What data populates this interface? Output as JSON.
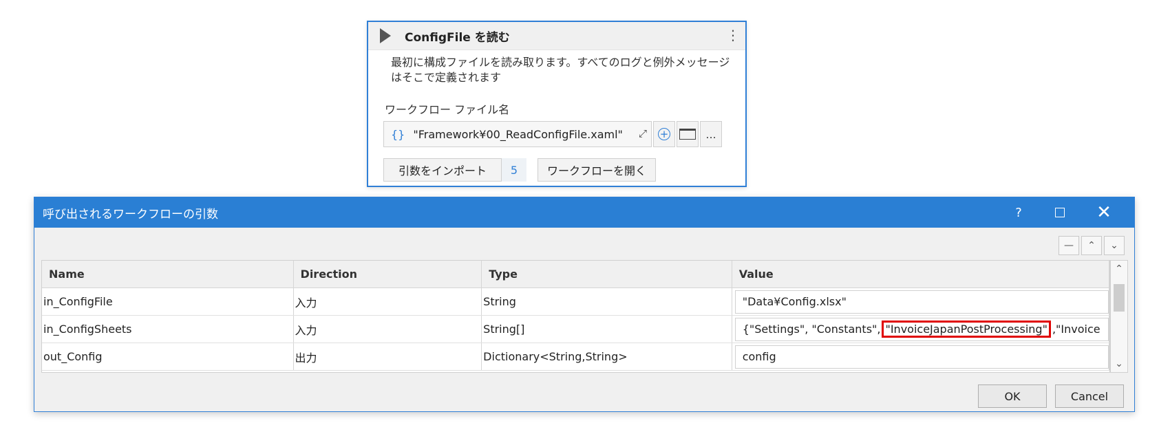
{
  "activity": {
    "title": "ConfigFile を読む",
    "more_icon": "⋮",
    "description": "最初に構成ファイルを読み取ります。すべてのログと例外メッセージはそこで定義されます",
    "workflow_label": "ワークフロー ファイル名",
    "workflow_file": "\"Framework¥00_ReadConfigFile.xaml\"",
    "brace_icon": "{}",
    "expand_icon": "⤢",
    "plus_icon": "+",
    "ellipsis": "...",
    "import_button": "引数をインポート",
    "import_count": "5",
    "open_button": "ワークフローを開く"
  },
  "dialog": {
    "title": "呼び出されるワークフローの引数",
    "help": "?",
    "close": "✕",
    "toolbar": {
      "minus": "—",
      "up": "⌃",
      "down": "⌄"
    },
    "columns": [
      "Name",
      "Direction",
      "Type",
      "Value"
    ],
    "rows": [
      {
        "name": "in_ConfigFile",
        "direction": "入力",
        "type": "String",
        "value": "\"Data¥Config.xlsx\""
      },
      {
        "name": "in_ConfigSheets",
        "direction": "入力",
        "type": "String[]",
        "value_pre": "{\"Settings\", \"Constants\",",
        "value_highlight": "\"InvoiceJapanPostProcessing\"",
        "value_post": ",\"Invoice"
      },
      {
        "name": "out_Config",
        "direction": "出力",
        "type": "Dictionary<String,String>",
        "value": "config"
      }
    ],
    "ok_button": "OK",
    "cancel_button": "Cancel",
    "scroll_up": "⌃",
    "scroll_down": "⌄"
  }
}
